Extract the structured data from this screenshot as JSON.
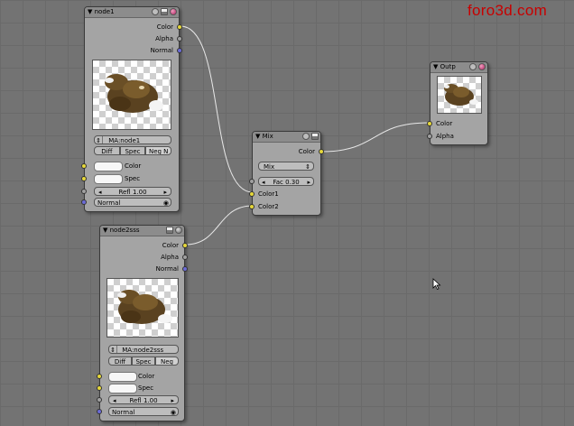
{
  "watermark": "foro3d.com",
  "node1": {
    "title": "node1",
    "outputs": [
      "Color",
      "Alpha",
      "Normal"
    ],
    "material": "MA:node1",
    "tabs": [
      "Diff",
      "Spec",
      "Neg N"
    ],
    "inputs": [
      "Color",
      "Spec"
    ],
    "refl": "Refl 1.00",
    "normal": "Normal"
  },
  "node2": {
    "title": "node2sss",
    "outputs": [
      "Color",
      "Alpha",
      "Normal"
    ],
    "material": "MA:node2sss",
    "tabs": [
      "Diff",
      "Spec",
      "Neg"
    ],
    "inputs": [
      "Color",
      "Spec"
    ],
    "refl": "Refl 1.00",
    "normal": "Normal"
  },
  "mix": {
    "title": "Mix",
    "output": "Color",
    "mode": "Mix",
    "fac": "Fac 0.30",
    "inputs": [
      "Color1",
      "Color2"
    ]
  },
  "output": {
    "title": "Outp",
    "inputs": [
      "Color",
      "Alpha"
    ]
  },
  "icons": {
    "collapse": "triangle-down-icon",
    "add": "plus-icon",
    "toggle": "preview-toggle-icon",
    "sphere": "material-sphere-icon",
    "cursor": "mouse-cursor-icon"
  },
  "colors": {
    "background": "#737373",
    "node": "#a4a4a4",
    "socket_color": "#e6d83a",
    "socket_value": "#a0a0a0",
    "socket_vector": "#6b6bd6",
    "watermark": "#c80000"
  }
}
